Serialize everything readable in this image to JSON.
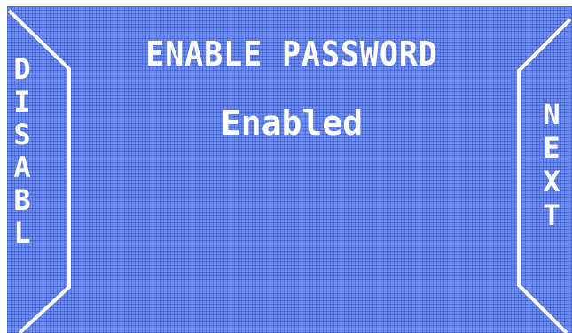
{
  "screen": {
    "title": "ENABLE PASSWORD",
    "status": "Enabled"
  },
  "left_button": {
    "label": "DISABL"
  },
  "right_button": {
    "label": "NEXT"
  },
  "colors": {
    "background": "#6a8cf0",
    "grid": "#283caa",
    "foreground": "#ffffff"
  }
}
